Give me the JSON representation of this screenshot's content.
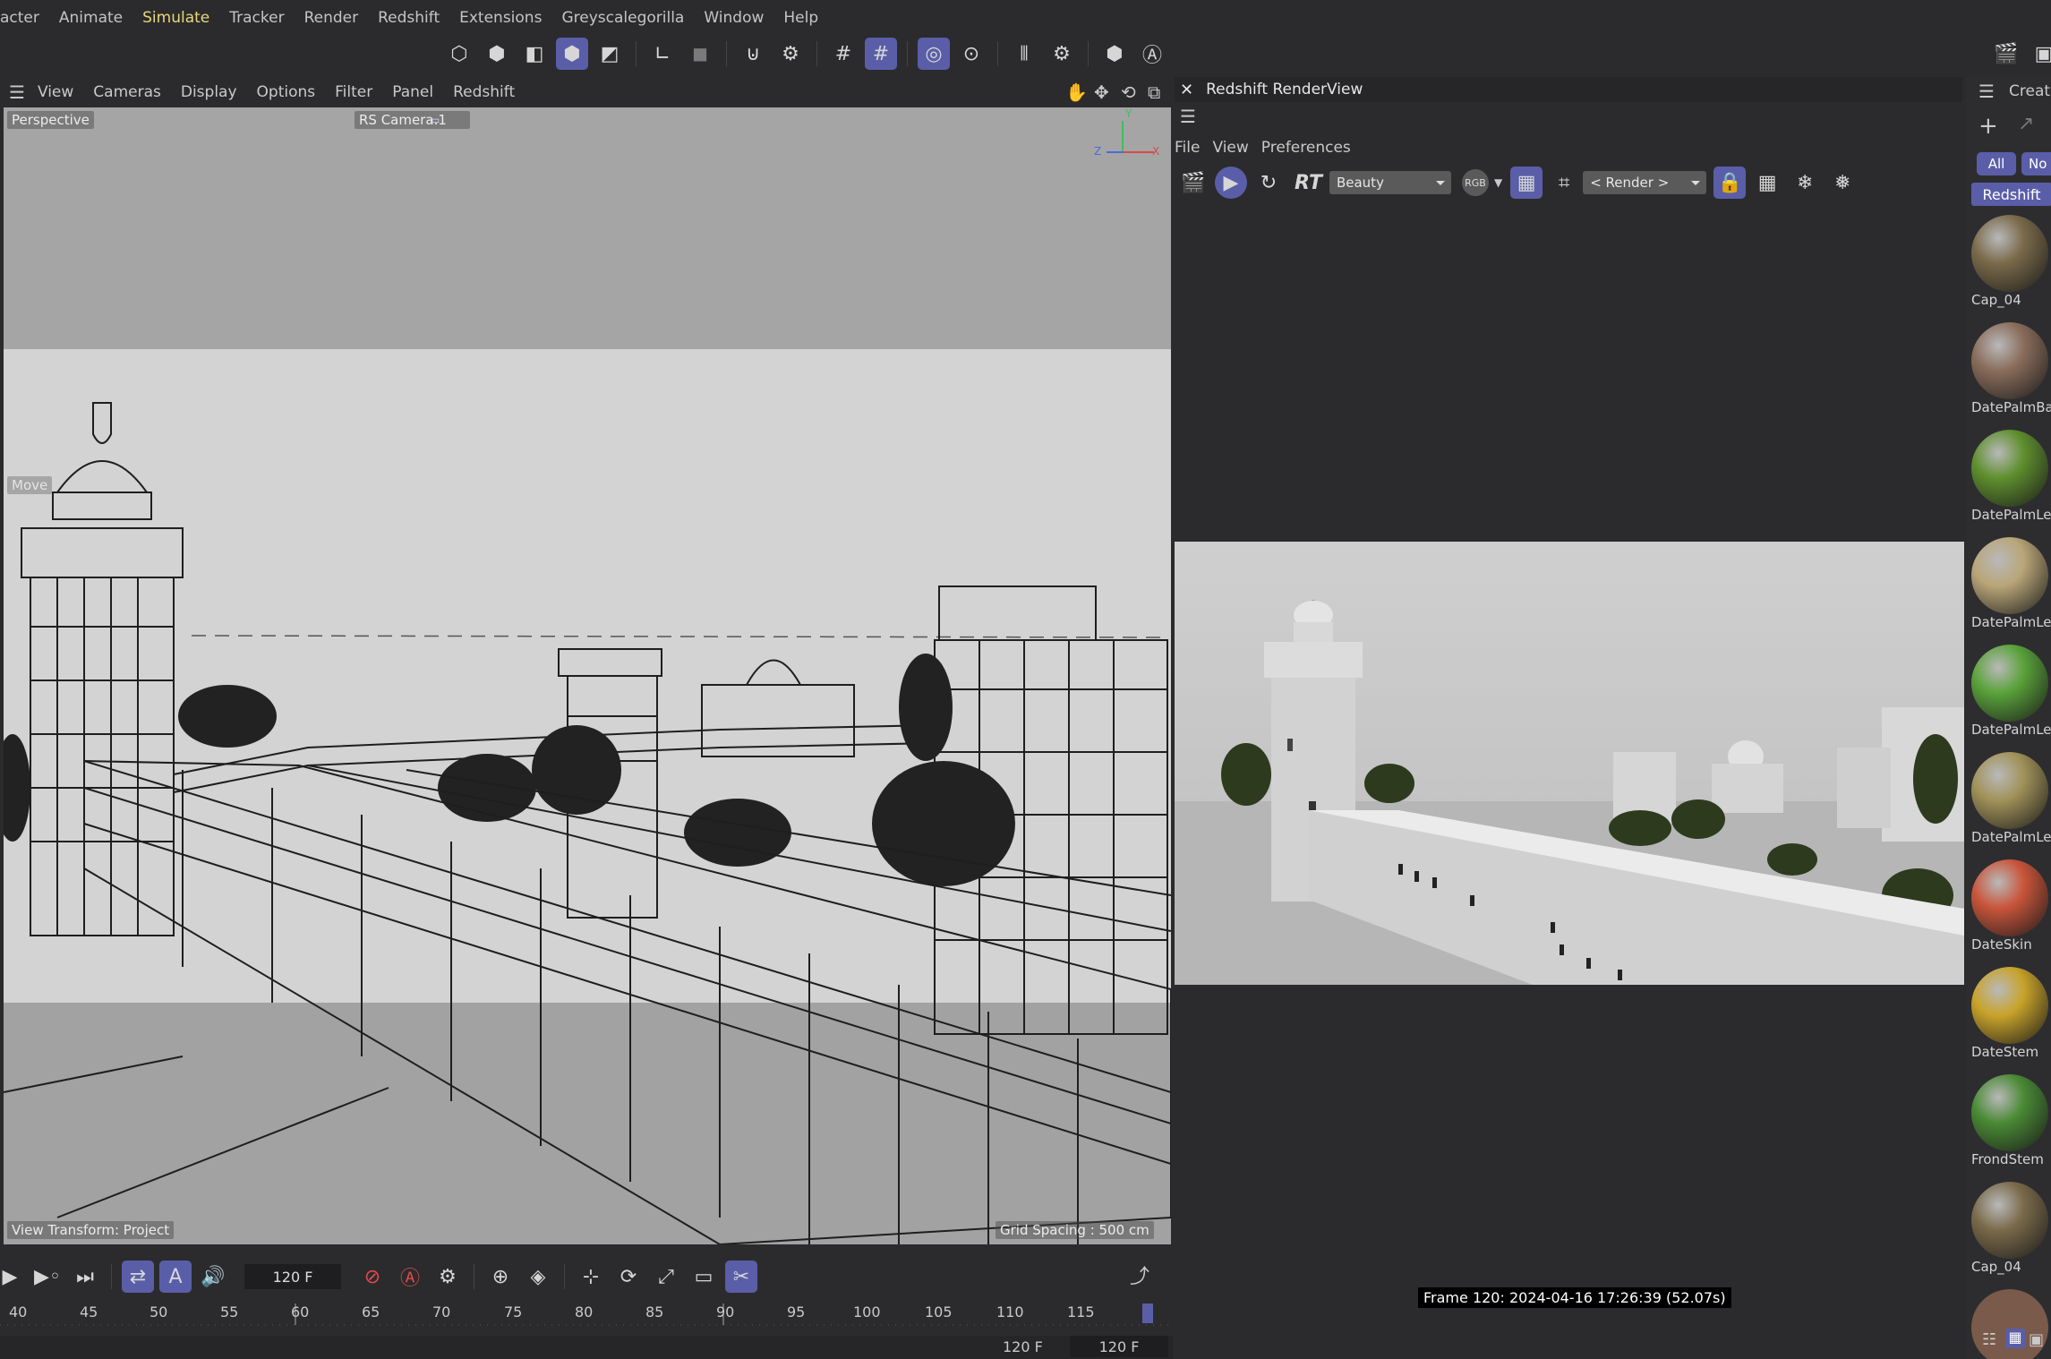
{
  "menu": [
    "acter",
    "Animate",
    "Simulate",
    "Tracker",
    "Render",
    "Redshift",
    "Extensions",
    "Greyscalegorilla",
    "Window",
    "Help"
  ],
  "menu_active": "Simulate",
  "viewport": {
    "menu": [
      "View",
      "Cameras",
      "Display",
      "Options",
      "Filter",
      "Panel",
      "Redshift"
    ],
    "label": "Perspective",
    "camera": "RS Camera.1",
    "move_label": "Move",
    "view_transform": "View Transform: Project",
    "grid_spacing": "Grid Spacing : 500 cm",
    "axis": {
      "y": "Y",
      "z": "Z",
      "x": "X"
    }
  },
  "renderview": {
    "title": "Redshift RenderView",
    "menu": [
      "File",
      "View",
      "Preferences"
    ],
    "rt_label": "RT",
    "aov": "Beauty",
    "rgb": "RGB",
    "render_dd": "< Render >",
    "frame_info": "Frame  120:  2024-04-16  17:26:39  (52.07s)"
  },
  "materials": {
    "header": "Create",
    "filter_all": "All",
    "filter_no": "No",
    "tag": "Redshift",
    "items": [
      {
        "name": "Cap_04",
        "color": "#7a6a4a"
      },
      {
        "name": "DatePalmBa",
        "color": "#8a6d5b"
      },
      {
        "name": "DatePalmLe",
        "color": "#5f8f2e"
      },
      {
        "name": "DatePalmLe",
        "color": "#b9a678"
      },
      {
        "name": "DatePalmLe",
        "color": "#5aa23a"
      },
      {
        "name": "DatePalmLe",
        "color": "#a19259"
      },
      {
        "name": "DateSkin",
        "color": "#c9553a"
      },
      {
        "name": "DateStem",
        "color": "#c8a32a"
      },
      {
        "name": "FrondStem",
        "color": "#4a8a35"
      },
      {
        "name": "Cap_04",
        "color": "#7a6a4a"
      }
    ]
  },
  "timeline": {
    "frame_field": "120 F",
    "end_field": "120 F",
    "end_field2": "120 F",
    "ticks": [
      "40",
      "45",
      "50",
      "55",
      "60",
      "65",
      "70",
      "75",
      "80",
      "85",
      "90",
      "95",
      "100",
      "105",
      "110",
      "115"
    ]
  }
}
